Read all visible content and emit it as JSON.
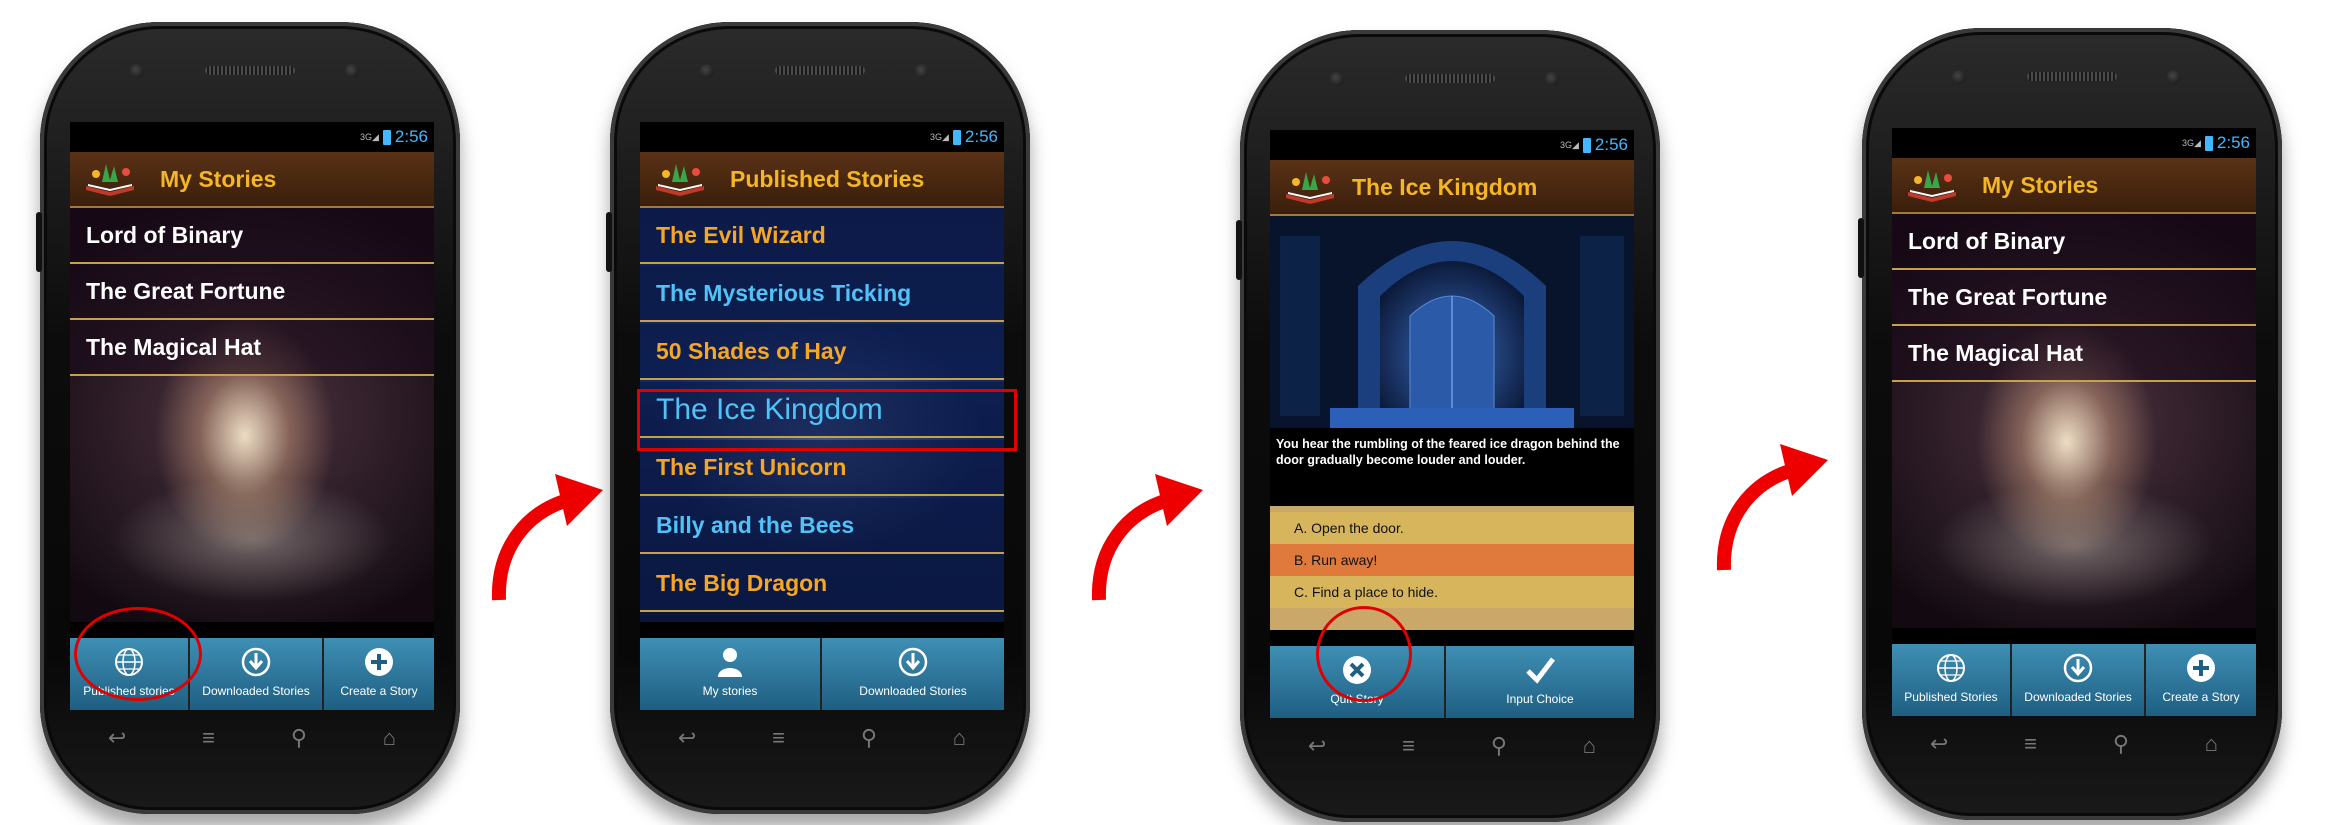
{
  "status": {
    "network": "3G",
    "time": "2:56"
  },
  "screen1": {
    "title": "My Stories",
    "items": [
      "Lord of Binary",
      "The Great Fortune",
      "The Magical Hat"
    ],
    "tabs": [
      "Published stories",
      "Downloaded Stories",
      "Create a Story"
    ]
  },
  "screen2": {
    "title": "Published Stories",
    "items": [
      {
        "label": "The Evil Wizard",
        "color": "#f5a623"
      },
      {
        "label": "The Mysterious Ticking",
        "color": "#4fc3f7"
      },
      {
        "label": "50 Shades of Hay",
        "color": "#f5a623"
      },
      {
        "label": "The Ice Kingdom",
        "color": "#4fc3f7"
      },
      {
        "label": "The First Unicorn",
        "color": "#f5a623"
      },
      {
        "label": "Billy and the Bees",
        "color": "#4fc3f7"
      },
      {
        "label": "The Big Dragon",
        "color": "#f5a623"
      }
    ],
    "tabs": [
      "My stories",
      "Downloaded Stories"
    ]
  },
  "screen3": {
    "title": "The Ice Kingdom",
    "text": "You hear the rumbling of the feared ice dragon behind the door gradually become louder and louder.",
    "choices": [
      "A. Open the door.",
      "B. Run away!",
      "C. Find a place to hide."
    ],
    "tabs": [
      "Quit Story",
      "Input Choice"
    ]
  },
  "screen4": {
    "title": "My Stories",
    "items": [
      "Lord of Binary",
      "The Great Fortune",
      "The Magical Hat"
    ],
    "tabs": [
      "Published Stories",
      "Downloaded Stories",
      "Create a Story"
    ]
  },
  "colors": {
    "accent_title": "#f5b626",
    "highlight_ring": "#e10000",
    "tab_blue": "#2e7aa0"
  }
}
